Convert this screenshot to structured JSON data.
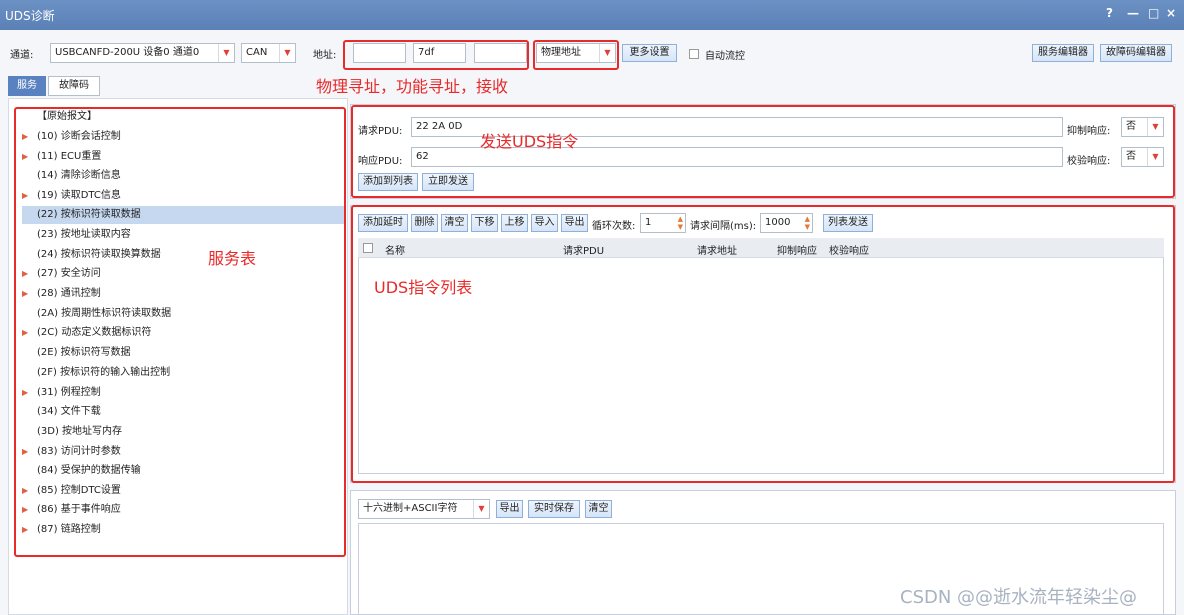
{
  "window": {
    "title": "UDS诊断",
    "help": "?",
    "minimize": "—",
    "maximize": "□",
    "close": "×"
  },
  "toolbar": {
    "channel_label": "通道:",
    "channel_value": "USBCANFD-200U 设备0 通道0",
    "bus_value": "CAN",
    "address_label": "地址:",
    "address_1": "",
    "address_2": "7df",
    "address_3": "",
    "addr_type": "物理地址",
    "more_settings": "更多设置",
    "auto_flow": "自动流控",
    "service_editor": "服务编辑器",
    "dtc_editor": "故障码编辑器"
  },
  "tabs": [
    {
      "label": "服务",
      "active": true
    },
    {
      "label": "故障码",
      "active": false
    }
  ],
  "tree": {
    "items": [
      {
        "label": "【原始报文】",
        "expandable": false
      },
      {
        "label": "(10) 诊断会话控制",
        "expandable": true
      },
      {
        "label": "(11) ECU重置",
        "expandable": true
      },
      {
        "label": "(14) 清除诊断信息",
        "expandable": false
      },
      {
        "label": "(19) 读取DTC信息",
        "expandable": true
      },
      {
        "label": "(22) 按标识符读取数据",
        "expandable": false,
        "selected": true
      },
      {
        "label": "(23) 按地址读取内容",
        "expandable": false
      },
      {
        "label": "(24) 按标识符读取换算数据",
        "expandable": false
      },
      {
        "label": "(27) 安全访问",
        "expandable": true
      },
      {
        "label": "(28) 通讯控制",
        "expandable": true
      },
      {
        "label": "(2A) 按周期性标识符读取数据",
        "expandable": false
      },
      {
        "label": "(2C) 动态定义数据标识符",
        "expandable": true
      },
      {
        "label": "(2E) 按标识符写数据",
        "expandable": false
      },
      {
        "label": "(2F) 按标识符的输入输出控制",
        "expandable": false
      },
      {
        "label": "(31) 例程控制",
        "expandable": true
      },
      {
        "label": "(34) 文件下载",
        "expandable": false
      },
      {
        "label": "(3D) 按地址写内存",
        "expandable": false
      },
      {
        "label": "(83) 访问计时参数",
        "expandable": true
      },
      {
        "label": "(84) 受保护的数据传输",
        "expandable": false
      },
      {
        "label": "(85) 控制DTC设置",
        "expandable": true
      },
      {
        "label": "(86) 基于事件响应",
        "expandable": true
      },
      {
        "label": "(87) 链路控制",
        "expandable": true
      }
    ]
  },
  "send": {
    "req_label": "请求PDU:",
    "req_value": "22 2A 0D",
    "resp_label": "响应PDU:",
    "resp_value": "62",
    "suppress_label": "抑制响应:",
    "suppress_value": "否",
    "verify_label": "校验响应:",
    "verify_value": "否",
    "add_to_list": "添加到列表",
    "send_now": "立即发送"
  },
  "list": {
    "btn_add_delay": "添加延时",
    "btn_delete": "删除",
    "btn_clear": "清空",
    "btn_down": "下移",
    "btn_up": "上移",
    "btn_import": "导入",
    "btn_export": "导出",
    "loop_label": "循环次数:",
    "loop_value": "1",
    "interval_label": "请求间隔(ms):",
    "interval_value": "1000",
    "btn_list_send": "列表发送",
    "columns": [
      "名称",
      "请求PDU",
      "请求地址",
      "抑制响应",
      "校验响应"
    ]
  },
  "log": {
    "format": "十六进制+ASCII字符",
    "btn_export": "导出",
    "btn_live_save": "实时保存",
    "btn_clear": "清空"
  },
  "annotations": {
    "addressing": "物理寻址，功能寻址，接收",
    "send_cmd": "发送UDS指令",
    "service_table": "服务表",
    "cmd_list": "UDS指令列表"
  },
  "watermark": "CSDN @@逝水流年轻染尘@",
  "colors": {
    "titlebar": "#5a80b6",
    "annotation": "#e82a2a",
    "selected": "#c5d8f0",
    "tab_active": "#5a82c0"
  }
}
